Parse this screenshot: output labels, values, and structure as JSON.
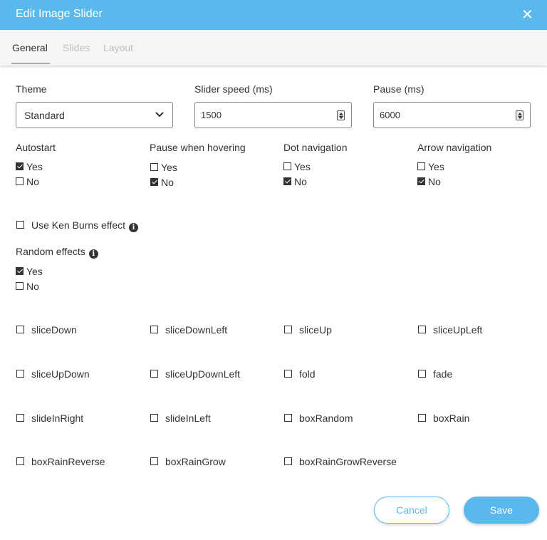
{
  "dialog": {
    "title": "Edit Image Slider",
    "close_icon": "close-icon",
    "accent_color": "#5ab9ec"
  },
  "tabs": [
    {
      "label": "General",
      "active": true
    },
    {
      "label": "Slides",
      "active": false
    },
    {
      "label": "Layout",
      "active": false
    }
  ],
  "fields": {
    "theme": {
      "label": "Theme",
      "value": "Standard"
    },
    "slider_speed": {
      "label": "Slider speed (ms)",
      "value": "1500"
    },
    "pause": {
      "label": "Pause (ms)",
      "value": "6000"
    }
  },
  "options": [
    {
      "label": "Autostart",
      "yes": "Yes",
      "no": "No",
      "selected": "yes"
    },
    {
      "label": "Pause when hovering",
      "yes": "Yes",
      "no": "No",
      "selected": "no"
    },
    {
      "label": "Dot navigation",
      "yes": "Yes",
      "no": "No",
      "selected": "no"
    },
    {
      "label": "Arrow navigation",
      "yes": "Yes",
      "no": "No",
      "selected": "no"
    }
  ],
  "ken_burns": {
    "label": "Use Ken Burns effect",
    "checked": false,
    "info_icon": "info-icon"
  },
  "random_effects": {
    "label": "Random effects",
    "yes": "Yes",
    "no": "No",
    "selected": "yes",
    "info_icon": "info-icon"
  },
  "effects": [
    {
      "label": "sliceDown",
      "checked": false
    },
    {
      "label": "sliceDownLeft",
      "checked": false
    },
    {
      "label": "sliceUp",
      "checked": false
    },
    {
      "label": "sliceUpLeft",
      "checked": false
    },
    {
      "label": "sliceUpDown",
      "checked": false
    },
    {
      "label": "sliceUpDownLeft",
      "checked": false
    },
    {
      "label": "fold",
      "checked": false
    },
    {
      "label": "fade",
      "checked": false
    },
    {
      "label": "slideInRight",
      "checked": false
    },
    {
      "label": "slideInLeft",
      "checked": false
    },
    {
      "label": "boxRandom",
      "checked": false
    },
    {
      "label": "boxRain",
      "checked": false
    },
    {
      "label": "boxRainReverse",
      "checked": false
    },
    {
      "label": "boxRainGrow",
      "checked": false
    },
    {
      "label": "boxRainGrowReverse",
      "checked": false
    }
  ],
  "buttons": {
    "cancel": "Cancel",
    "save": "Save"
  }
}
